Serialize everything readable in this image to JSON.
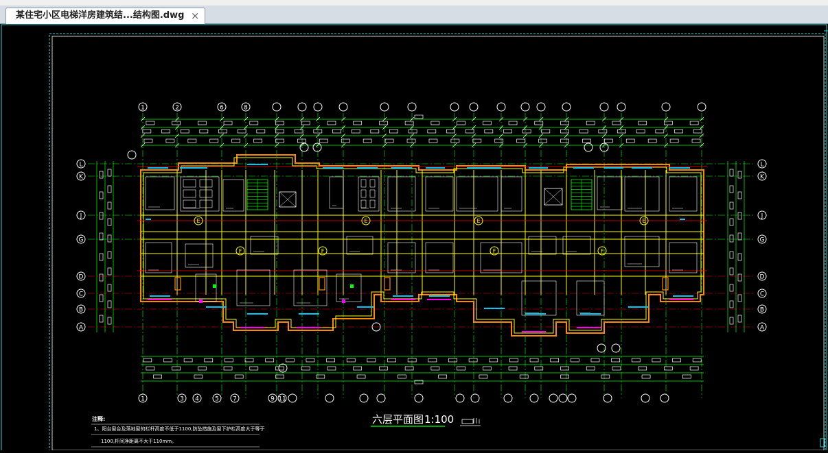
{
  "tab": {
    "title": "某住宅小区电梯洋房建筑结...结构图.dwg",
    "close": "×"
  },
  "drawing": {
    "title": "六层平面图",
    "scale": "1:100",
    "notes_heading": "注释:",
    "note_1a": "1、阳台窗台及落地窗的栏杆高度不低于1100,防坠措施及窗下护栏高度大于等于",
    "note_1b": "1100,杆间净距离不大于110mm。",
    "axis_top": [
      "1",
      "2",
      "6",
      "8",
      "",
      "",
      "",
      "",
      "",
      "",
      "",
      "",
      "",
      "",
      "",
      "",
      "",
      "",
      "",
      "",
      "",
      ""
    ],
    "axis_bottom": [
      "1",
      "3",
      "4",
      "5",
      "7",
      "9",
      "11",
      "",
      "",
      "",
      "",
      "",
      "",
      "",
      "",
      "",
      "",
      "",
      "",
      "",
      ""
    ],
    "axis_rows": [
      "L",
      "K",
      "J",
      "G",
      "D",
      "C",
      "B",
      "A"
    ],
    "room_marks": [
      "E",
      "E",
      "E",
      "E",
      "F",
      "F",
      "F",
      "F"
    ]
  },
  "colors": {
    "canvas": "#000000",
    "frame": "#3ad0d0",
    "axis": "#00ff00",
    "wall": "#ffff00",
    "red": "#ff0000",
    "window": "#00c8ff",
    "magenta": "#ff00ff",
    "text": "#ffffff"
  }
}
